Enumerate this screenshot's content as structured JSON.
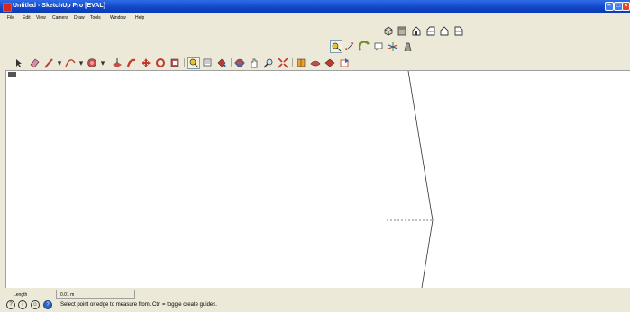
{
  "window": {
    "title": "Untitled - SketchUp Pro [EVAL]",
    "min_glyph": "–",
    "max_glyph": "□",
    "close_glyph": "×"
  },
  "menu": {
    "items": [
      "File",
      "Edit",
      "View",
      "Camera",
      "Draw",
      "Tools",
      "Window",
      "Help"
    ]
  },
  "views_toolbar": {
    "icons": [
      "iso-view-icon",
      "top-view-icon",
      "front-view-icon",
      "right-view-icon",
      "back-view-icon",
      "left-view-icon"
    ]
  },
  "construction_toolbar": {
    "icons": [
      "tape-measure-icon",
      "dimension-icon",
      "protractor-icon",
      "text-icon",
      "axes-icon",
      "3d-text-icon"
    ]
  },
  "large_toolbar": {
    "icons": [
      "select-icon",
      "eraser-icon",
      "pencil-icon",
      "line-dropdown-icon",
      "arc-icon",
      "arc-dropdown-icon",
      "shape-icon",
      "shape-dropdown-icon",
      "push-pull-icon",
      "follow-me-icon",
      "move-icon",
      "rotate-icon",
      "scale-icon",
      "tape-measure-icon",
      "text-icon",
      "paint-bucket-icon",
      "orbit-icon",
      "pan-icon",
      "zoom-icon",
      "zoom-extents-icon",
      "section-plane-icon",
      "components-icon",
      "warehouse-icon",
      "share-model-icon"
    ]
  },
  "measurements": {
    "label": "Length",
    "value": "0.01 m"
  },
  "status": {
    "icons": [
      "geo-location-icon",
      "credits-icon",
      "user-icon",
      "help-icon"
    ],
    "hint": "Select point or edge to measure from.  Ctrl = toggle create guides."
  },
  "colors": {
    "titlebar": "#1246c8",
    "chrome": "#ece9d8",
    "viewport": "#ffffff"
  }
}
